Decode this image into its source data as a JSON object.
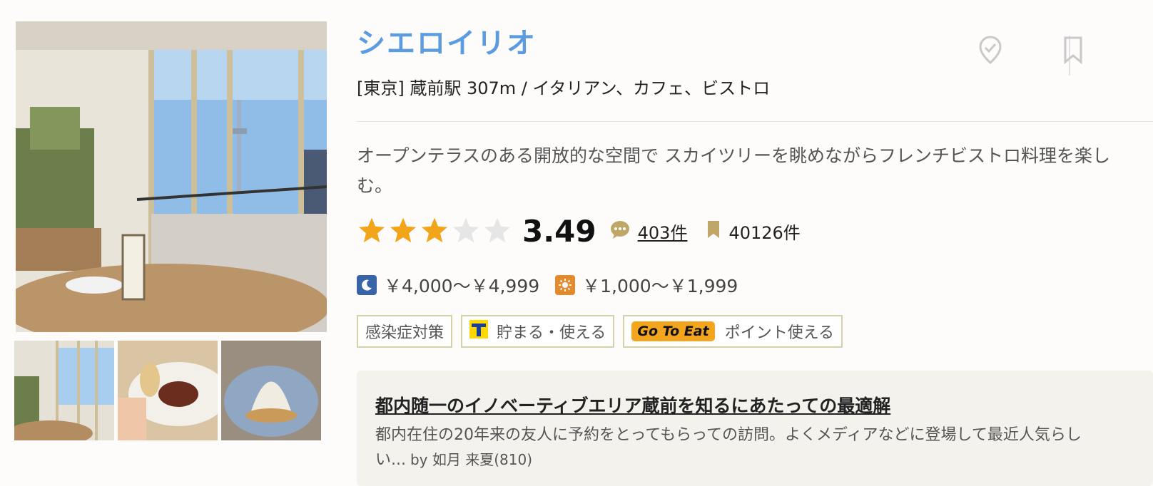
{
  "shop": {
    "name": "シエロイリオ",
    "area_genre": "[東京] 蔵前駅 307m / イタリアン、カフェ、ビストロ",
    "pr": "オープンテラスのある開放的な空間で スカイツリーを眺めながらフレンチビストロ料理を楽しむ。"
  },
  "rating": {
    "stars": 3,
    "max_stars": 5,
    "score": "3.49",
    "review_count": "403件",
    "save_count": "40126件"
  },
  "budget": {
    "dinner": "￥4,000～￥4,999",
    "lunch": "￥1,000～￥1,999"
  },
  "badges": {
    "covid": "感染症対策",
    "tpoint": "貯まる・使える",
    "goto_logo": "Go To Eat",
    "goto": "ポイント使える"
  },
  "review": {
    "title": "都内随一のイノベーティブエリア蔵前を知るにあたっての最適解",
    "body": "都内在住の20年来の友人に予約をとってもらっての訪問。よくメディアなどに登場して最近人気らしい...",
    "author": "by 如月 来夏(810)"
  },
  "colors": {
    "name": "#5b9be0",
    "star_on": "#f2a51a",
    "star_off": "#e6e6e6",
    "goto": "#f3a61d",
    "badge_border": "#d7d0a8",
    "tpoint_blue": "#1b3f9b",
    "tpoint_yellow": "#ffd800"
  },
  "icons": [
    "visited-pin-icon",
    "bookmark-icon",
    "star-icon",
    "comment-icon",
    "saved-bookmark-icon",
    "moon-icon",
    "sun-icon",
    "tpoint-icon"
  ]
}
